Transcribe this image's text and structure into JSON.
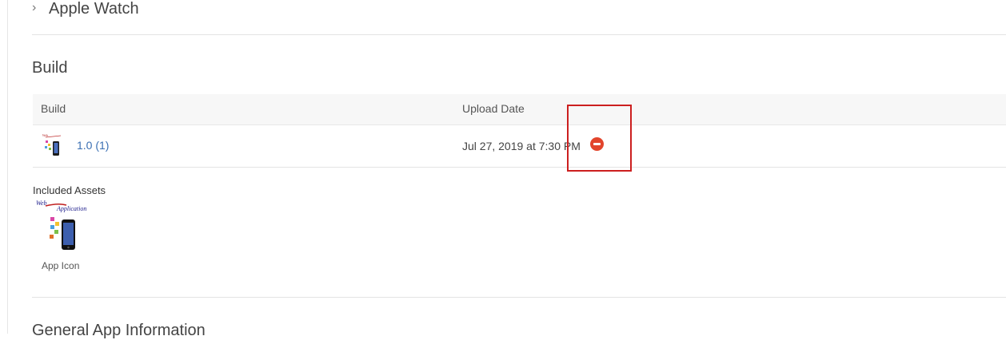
{
  "apple_watch": {
    "chevron": "›",
    "title": "Apple Watch"
  },
  "build_section": {
    "title": "Build",
    "columns": [
      "Build",
      "Upload Date"
    ],
    "rows": [
      {
        "build": "1.0 (1)",
        "upload_date": "Jul 27, 2019 at 7:30 PM",
        "status_icon": "remove-icon",
        "status_color": "#e2452c"
      }
    ]
  },
  "included_assets": {
    "title": "Included Assets",
    "app_icon_label": "App Icon",
    "icon_text_web": "Web",
    "icon_text_application": "Application"
  },
  "general_section": {
    "title": "General App Information"
  },
  "colors": {
    "link": "#3a6fb3",
    "highlight": "#cc1f1f"
  }
}
